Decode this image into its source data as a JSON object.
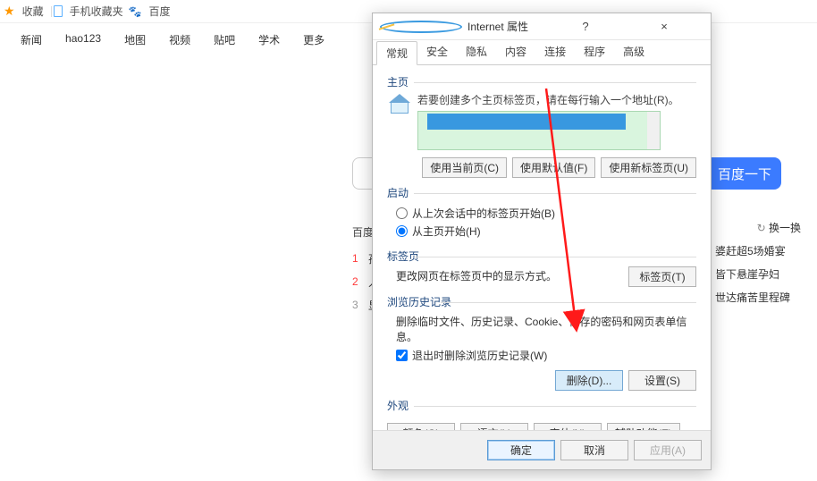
{
  "topbar": {
    "fav": "收藏",
    "mobile": "手机收藏夹",
    "baidu": "百度"
  },
  "nav": [
    "新闻",
    "hao123",
    "地图",
    "视频",
    "贴吧",
    "学术",
    "更多"
  ],
  "search": {
    "button": "百度一下"
  },
  "hot": {
    "title": "百度",
    "refresh": "换一换",
    "items": [
      "孙",
      "人",
      "显"
    ]
  },
  "side": [
    "婆赶超5场婚宴",
    "皆下悬崖孕妇",
    "世达痛苦里程碑"
  ],
  "dialog": {
    "title": "Internet 属性",
    "help": "?",
    "close": "×",
    "tabs": [
      "常规",
      "安全",
      "隐私",
      "内容",
      "连接",
      "程序",
      "高级"
    ],
    "home": {
      "legend": "主页",
      "desc": "若要创建多个主页标签页，请在每行输入一个地址(R)。",
      "btns": [
        "使用当前页(C)",
        "使用默认值(F)",
        "使用新标签页(U)"
      ]
    },
    "startup": {
      "legend": "启动",
      "opt1": "从上次会话中的标签页开始(B)",
      "opt2": "从主页开始(H)"
    },
    "tabsPane": {
      "legend": "标签页",
      "desc": "更改网页在标签页中的显示方式。",
      "btn": "标签页(T)"
    },
    "history": {
      "legend": "浏览历史记录",
      "desc": "删除临时文件、历史记录、Cookie、保存的密码和网页表单信息。",
      "chk": "退出时删除浏览历史记录(W)",
      "del": "删除(D)...",
      "set": "设置(S)"
    },
    "appearance": {
      "legend": "外观",
      "btns": [
        "颜色(O)",
        "语言(L)",
        "字体(N)",
        "辅助功能(E)"
      ]
    },
    "footer": {
      "ok": "确定",
      "cancel": "取消",
      "apply": "应用(A)"
    }
  }
}
